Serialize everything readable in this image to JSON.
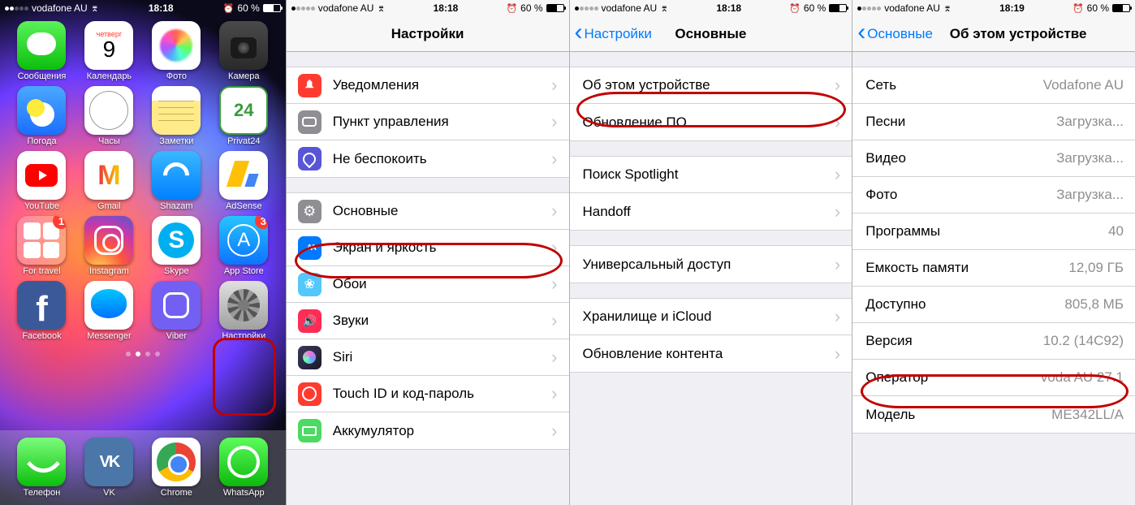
{
  "status": {
    "carrier": "vodafone AU",
    "time1": "18:18",
    "time4": "18:19",
    "battery_pct": "60 %",
    "alarm": "⏰"
  },
  "home": {
    "cal_day": "четверг",
    "cal_num": "9",
    "apps": {
      "messages": "Сообщения",
      "calendar": "Календарь",
      "photos": "Фото",
      "camera": "Камера",
      "weather": "Погода",
      "clock": "Часы",
      "notes": "Заметки",
      "privat24": "Privat24",
      "youtube": "YouTube",
      "gmail": "Gmail",
      "shazam": "Shazam",
      "adsense": "AdSense",
      "fortravel": "For travel",
      "instagram": "Instagram",
      "skype": "Skype",
      "appstore": "App Store",
      "facebook": "Facebook",
      "messenger": "Messenger",
      "viber": "Viber",
      "settings": "Настройки"
    },
    "badges": {
      "fortravel": "1",
      "appstore": "3"
    },
    "dock": {
      "phone": "Телефон",
      "vk": "VK",
      "chrome": "Chrome",
      "whatsapp": "WhatsApp"
    }
  },
  "pane2": {
    "title": "Настройки",
    "rows": {
      "notif": "Уведомления",
      "cc": "Пункт управления",
      "dnd": "Не беспокоить",
      "gen": "Основные",
      "disp": "Экран и яркость",
      "wall": "Обои",
      "sound": "Звуки",
      "siri": "Siri",
      "touch": "Touch ID и код-пароль",
      "batt": "Аккумулятор"
    }
  },
  "pane3": {
    "back": "Настройки",
    "title": "Основные",
    "rows": {
      "about": "Об этом устройстве",
      "update": "Обновление ПО",
      "spotlight": "Поиск Spotlight",
      "handoff": "Handoff",
      "access": "Универсальный доступ",
      "storage": "Хранилище и iCloud",
      "refresh": "Обновление контента"
    }
  },
  "pane4": {
    "back": "Основные",
    "title": "Об этом устройстве",
    "rows": [
      {
        "k": "Сеть",
        "v": "Vodafone AU"
      },
      {
        "k": "Песни",
        "v": "Загрузка..."
      },
      {
        "k": "Видео",
        "v": "Загрузка..."
      },
      {
        "k": "Фото",
        "v": "Загрузка..."
      },
      {
        "k": "Программы",
        "v": "40"
      },
      {
        "k": "Емкость памяти",
        "v": "12,09 ГБ"
      },
      {
        "k": "Доступно",
        "v": "805,8 МБ"
      },
      {
        "k": "Версия",
        "v": "10.2 (14C92)"
      },
      {
        "k": "Оператор",
        "v": "voda AU 27.1"
      },
      {
        "k": "Модель",
        "v": "ME342LL/A"
      }
    ]
  }
}
